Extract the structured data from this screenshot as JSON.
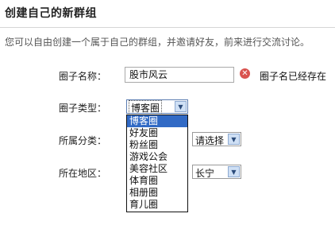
{
  "header": {
    "title": "创建自己的新群组",
    "description": "您可以自由创建一个属于自己的群组，并邀请好友，前来进行交流讨论。"
  },
  "form": {
    "name_label": "圈子名称：",
    "name_value": "股市风云",
    "name_error": "圈子名已经存在",
    "type_label": "圈子类型：",
    "type_selected": "博客圈",
    "type_options": [
      "博客圈",
      "好友圈",
      "粉丝圈",
      "游戏公会",
      "美容社区",
      "体育圈",
      "相册圈",
      "育儿圈"
    ],
    "category_label": "所属分类：",
    "category_selected": "请选择",
    "area_label": "所在地区：",
    "area_selected": "长宁"
  },
  "colors": {
    "error": "#d9534f",
    "highlight": "#316ac5"
  },
  "icons": {
    "error": "close-circle-icon",
    "dropdown": "triangle-down-icon"
  }
}
